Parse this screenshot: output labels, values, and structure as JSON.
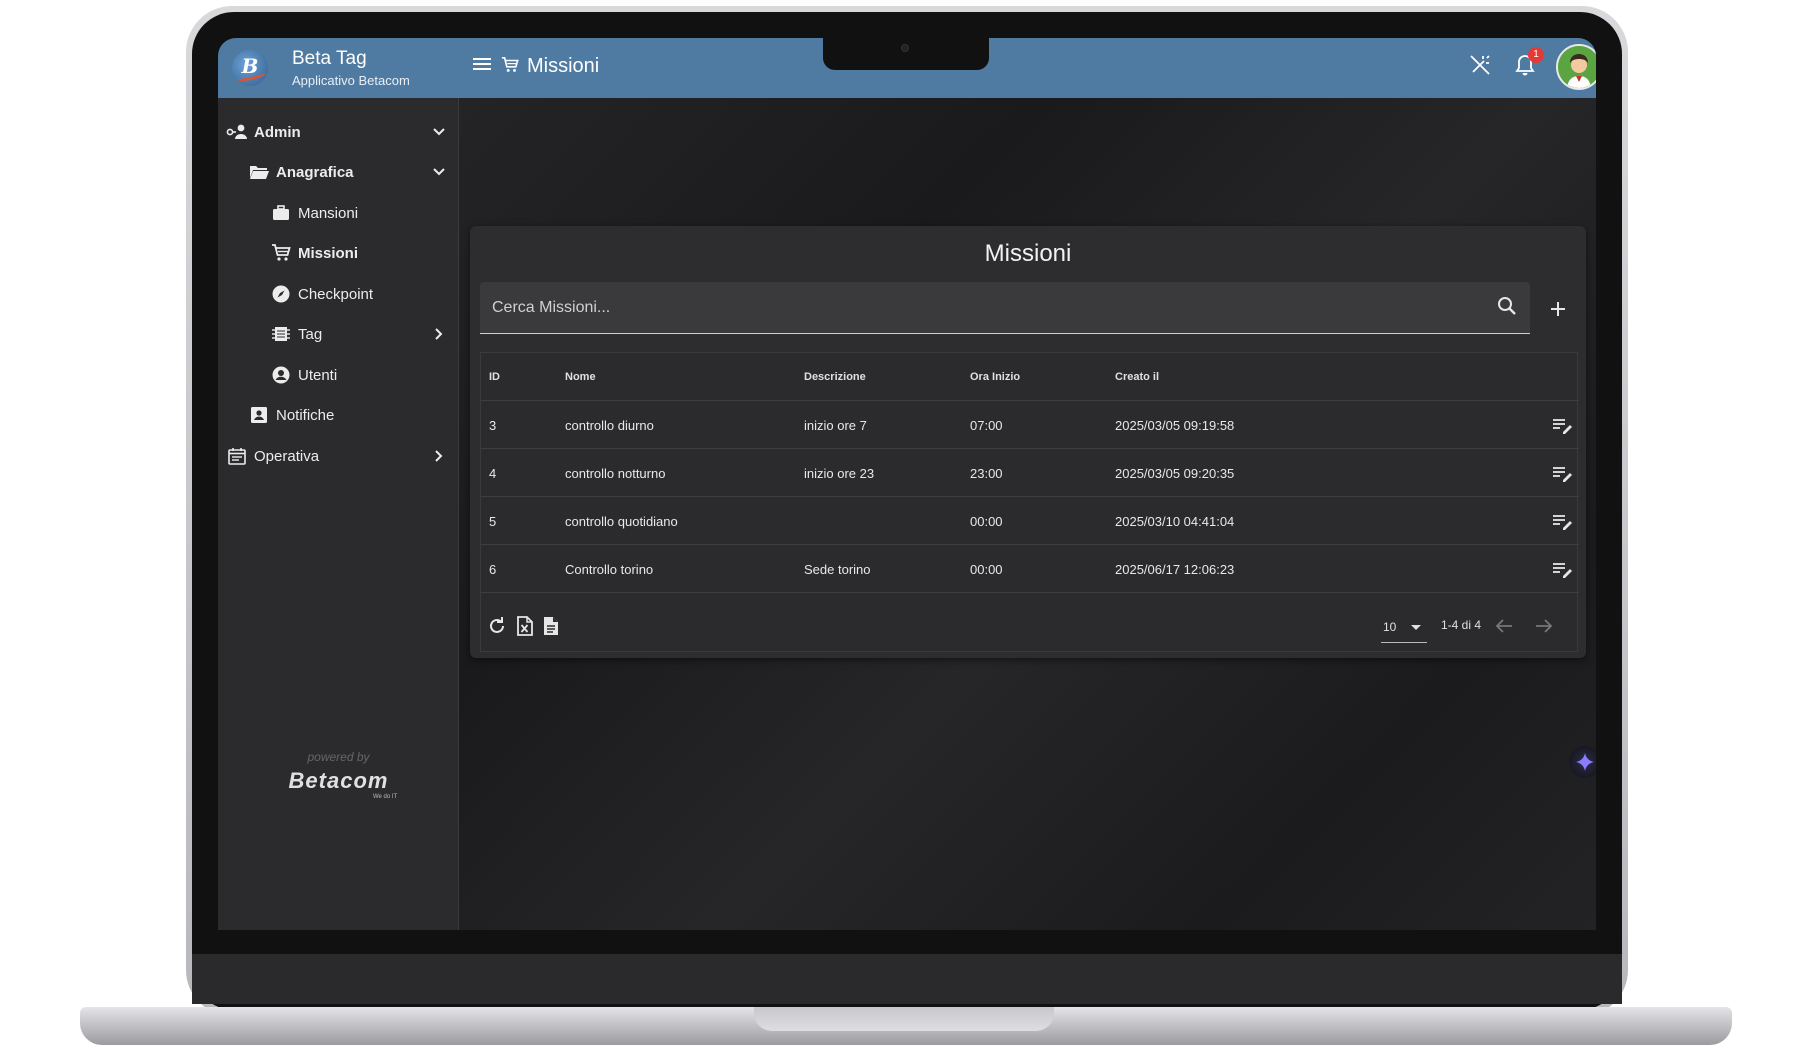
{
  "brand": {
    "title": "Beta Tag",
    "subtitle": "Applicativo Betacom",
    "logo_letter": "B"
  },
  "topbar": {
    "title": "Missioni",
    "notification_count": "1"
  },
  "sidebar": {
    "items": [
      {
        "label": "Admin",
        "icon": "admin-icon"
      },
      {
        "label": "Anagrafica",
        "icon": "folder-open-icon"
      },
      {
        "label": "Mansioni",
        "icon": "briefcase-icon"
      },
      {
        "label": "Missioni",
        "icon": "cart-icon"
      },
      {
        "label": "Checkpoint",
        "icon": "compass-icon"
      },
      {
        "label": "Tag",
        "icon": "chip-icon"
      },
      {
        "label": "Utenti",
        "icon": "account-circle-icon"
      },
      {
        "label": "Notifiche",
        "icon": "contact-card-icon"
      },
      {
        "label": "Operativa",
        "icon": "calendar-list-icon"
      }
    ],
    "powered_by": "powered by",
    "footer_logo": "Betacom",
    "footer_tagline": "We do IT"
  },
  "card": {
    "title": "Missioni",
    "search_placeholder": "Cerca Missioni..."
  },
  "table": {
    "columns": [
      "ID",
      "Nome",
      "Descrizione",
      "Ora Inizio",
      "Creato il"
    ],
    "rows": [
      [
        "3",
        "controllo diurno",
        "inizio ore 7",
        "07:00",
        "2025/03/05 09:19:58"
      ],
      [
        "4",
        "controllo notturno",
        "inizio ore 23",
        "23:00",
        "2025/03/05 09:20:35"
      ],
      [
        "5",
        "controllo quotidiano",
        "",
        "00:00",
        "2025/03/10 04:41:04"
      ],
      [
        "6",
        "Controllo torino",
        "Sede torino",
        "00:00",
        "2025/06/17 12:06:23"
      ]
    ]
  },
  "pagination": {
    "page_size": "10",
    "range": "1-4 di 4"
  },
  "colors": {
    "header_blue": "#4f7aa2",
    "panel": "#2d2d2f",
    "sidebar": "#2b2b2d",
    "badge_red": "#e53935"
  }
}
